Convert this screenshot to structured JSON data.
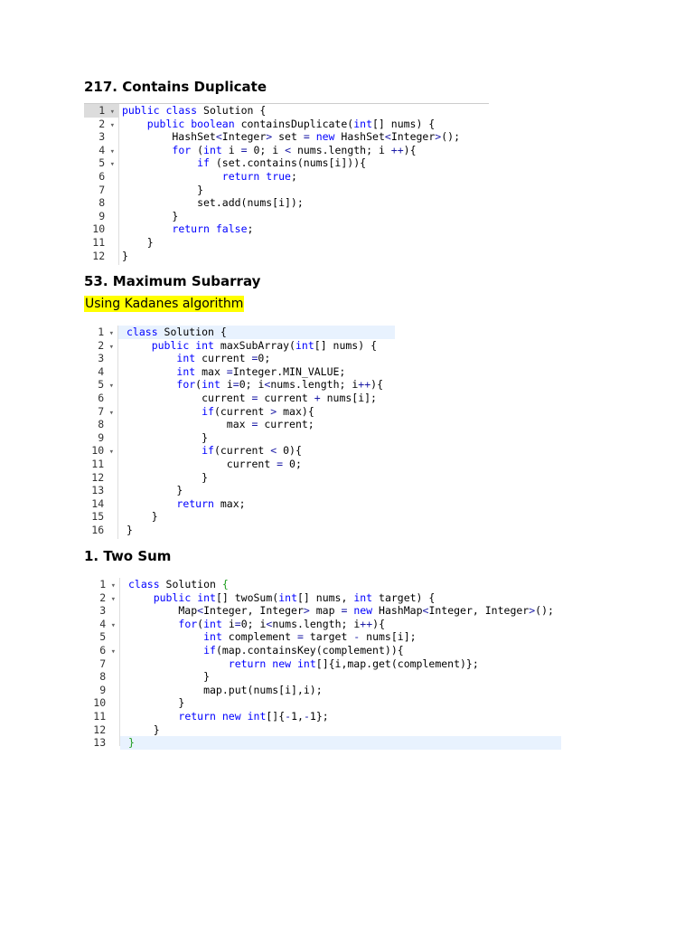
{
  "sections": [
    {
      "title": "217. Contains Duplicate"
    },
    {
      "title": "53. Maximum Subarray",
      "note": "Using Kadanes algorithm"
    },
    {
      "title": "1. Two Sum"
    }
  ],
  "code1": {
    "lines": [
      {
        "n": "1",
        "a": "▾",
        "t": "public class Solution {"
      },
      {
        "n": "2",
        "a": "▾",
        "t": "    public boolean containsDuplicate(int[] nums) {"
      },
      {
        "n": "3",
        "a": "",
        "t": "        HashSet<Integer> set = new HashSet<Integer>();"
      },
      {
        "n": "4",
        "a": "▾",
        "t": "        for (int i = 0; i < nums.length; i ++){"
      },
      {
        "n": "5",
        "a": "▾",
        "t": "            if (set.contains(nums[i])){"
      },
      {
        "n": "6",
        "a": "",
        "t": "                return true;"
      },
      {
        "n": "7",
        "a": "",
        "t": "            }"
      },
      {
        "n": "8",
        "a": "",
        "t": "            set.add(nums[i]);"
      },
      {
        "n": "9",
        "a": "",
        "t": "        }"
      },
      {
        "n": "10",
        "a": "",
        "t": "        return false;"
      },
      {
        "n": "11",
        "a": "",
        "t": "    }"
      },
      {
        "n": "12",
        "a": "",
        "t": "}"
      }
    ]
  },
  "code2": {
    "lines": [
      {
        "n": "1",
        "a": "▾",
        "t": "class Solution {"
      },
      {
        "n": "2",
        "a": "▾",
        "t": "    public int maxSubArray(int[] nums) {"
      },
      {
        "n": "3",
        "a": "",
        "t": "        int current =0;"
      },
      {
        "n": "4",
        "a": "",
        "t": "        int max =Integer.MIN_VALUE;"
      },
      {
        "n": "5",
        "a": "▾",
        "t": "        for(int i=0; i<nums.length; i++){"
      },
      {
        "n": "6",
        "a": "",
        "t": "            current = current + nums[i];"
      },
      {
        "n": "7",
        "a": "▾",
        "t": "            if(current > max){"
      },
      {
        "n": "8",
        "a": "",
        "t": "                max = current;"
      },
      {
        "n": "9",
        "a": "",
        "t": "            }"
      },
      {
        "n": "10",
        "a": "▾",
        "t": "            if(current < 0){"
      },
      {
        "n": "11",
        "a": "",
        "t": "                current = 0;"
      },
      {
        "n": "12",
        "a": "",
        "t": "            }"
      },
      {
        "n": "13",
        "a": "",
        "t": "        }"
      },
      {
        "n": "14",
        "a": "",
        "t": "        return max;"
      },
      {
        "n": "15",
        "a": "",
        "t": "    }"
      },
      {
        "n": "16",
        "a": "",
        "t": "}"
      }
    ]
  },
  "code3": {
    "lines": [
      {
        "n": "1",
        "a": "▾",
        "t": "class Solution {"
      },
      {
        "n": "2",
        "a": "▾",
        "t": "    public int[] twoSum(int[] nums, int target) {"
      },
      {
        "n": "3",
        "a": "",
        "t": "        Map<Integer, Integer> map = new HashMap<Integer, Integer>();"
      },
      {
        "n": "4",
        "a": "▾",
        "t": "        for(int i=0; i<nums.length; i++){"
      },
      {
        "n": "5",
        "a": "",
        "t": "            int complement = target - nums[i];"
      },
      {
        "n": "6",
        "a": "▾",
        "t": "            if(map.containsKey(complement)){"
      },
      {
        "n": "7",
        "a": "",
        "t": "                return new int[]{i,map.get(complement)};"
      },
      {
        "n": "8",
        "a": "",
        "t": "            }"
      },
      {
        "n": "9",
        "a": "",
        "t": "            map.put(nums[i],i);"
      },
      {
        "n": "10",
        "a": "",
        "t": "        }"
      },
      {
        "n": "11",
        "a": "",
        "t": "        return new int[]{-1,-1};"
      },
      {
        "n": "12",
        "a": "",
        "t": "    }"
      },
      {
        "n": "13",
        "a": "",
        "t": "}"
      }
    ]
  }
}
